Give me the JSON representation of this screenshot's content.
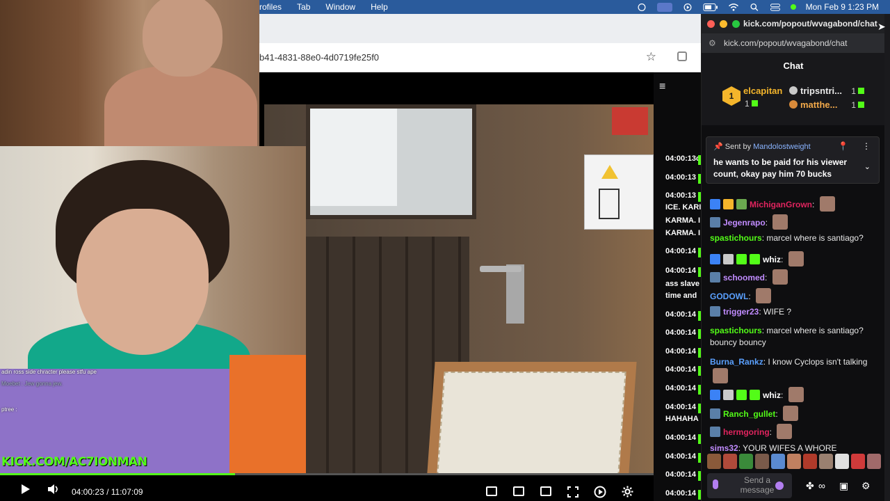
{
  "menubar": {
    "items": [
      "rofiles",
      "Tab",
      "Window",
      "Help"
    ],
    "clock": "Mon Feb 9  1:23 PM"
  },
  "browser": {
    "url_fragment": "b41-4831-88e0-4d0719fe25f0",
    "bookmark_icon": "star-icon"
  },
  "stream": {
    "overlay_lines": [
      "adin ross side chracter please stfu ape",
      "Moebet : Jew gonna jew.",
      "ptree : "
    ],
    "banner": "KICK.COM/AC7IONMAN",
    "progress_fraction": 0.36,
    "accent": "#53fc18"
  },
  "player": {
    "current_time": "04:00:23",
    "separator": "/",
    "duration": "11:07:09"
  },
  "strip": {
    "rows": [
      {
        "ts": "04:00:13",
        "text": "c"
      },
      {
        "ts": "04:00:13",
        "text": ""
      },
      {
        "ts": "04:00:13",
        "text": ""
      },
      {
        "ts": "",
        "text": "ICE. KARI"
      },
      {
        "ts": "",
        "text": "KARMA. I"
      },
      {
        "ts": "",
        "text": "KARMA. I"
      },
      {
        "ts": "04:00:14",
        "text": ""
      },
      {
        "ts": "04:00:14",
        "text": ""
      },
      {
        "ts": "",
        "text": "ass slave"
      },
      {
        "ts": "",
        "text": "time and"
      },
      {
        "ts": "04:00:14",
        "text": ""
      },
      {
        "ts": "04:00:14",
        "text": ""
      },
      {
        "ts": "04:00:14",
        "text": ""
      },
      {
        "ts": "04:00:14",
        "text": ""
      },
      {
        "ts": "04:00:14",
        "text": ""
      },
      {
        "ts": "04:00:14",
        "text": ""
      },
      {
        "ts": "",
        "text": "HAHAHA"
      },
      {
        "ts": "04:00:14",
        "text": ""
      },
      {
        "ts": "04:00:14",
        "text": ""
      },
      {
        "ts": "04:00:14",
        "text": ""
      },
      {
        "ts": "04:00:14",
        "text": ""
      }
    ]
  },
  "popout": {
    "title": "kick.com/popout/wvagabond/chat",
    "url": "kick.com/popout/wvagabond/chat",
    "header": "Chat"
  },
  "leaderboard": {
    "first": {
      "rank": "1",
      "name": "elcapitan",
      "count": "1"
    },
    "second": {
      "name": "tripsntri...",
      "count": "1"
    },
    "third": {
      "name": "matthe...",
      "count": "1"
    }
  },
  "pinned": {
    "sent_by_label": "Sent by",
    "sender": "Mandolostweight",
    "message": "he wants to be paid for his viewer count, okay pay him 70 bucks"
  },
  "chat": {
    "messages": [
      {
        "user": "MichiganGrown",
        "color": "#e0245e",
        "text": ""
      },
      {
        "user": "Jegenrapo",
        "color": "#c18cff",
        "text": ""
      },
      {
        "user": "spastichours",
        "color": "#53fc18",
        "text": "marcel where is santiago?"
      },
      {
        "user": "whiz",
        "color": "#ffffff",
        "text": ""
      },
      {
        "user": "schoomed",
        "color": "#c18cff",
        "text": ""
      },
      {
        "user": "GODOWL",
        "color": "#5aa0ff",
        "text": ""
      },
      {
        "user": "trigger23",
        "color": "#c18cff",
        "text": "WIFE ?"
      },
      {
        "user": "spastichours",
        "color": "#53fc18",
        "text": "marcel where is santiago? bouncy bouncy"
      },
      {
        "user": "Burna_Rankz",
        "color": "#5aa0ff",
        "text": "I know Cyclops isn't talking"
      },
      {
        "user": "whiz",
        "color": "#ffffff",
        "text": ""
      },
      {
        "user": "Ranch_gullet",
        "color": "#53fc18",
        "text": ""
      },
      {
        "user": "hermgoring",
        "color": "#e0245e",
        "text": ""
      },
      {
        "user": "sims32",
        "color": "#c18cff",
        "text": "YOUR WIFES A WHORE"
      }
    ]
  },
  "input": {
    "placeholder": "Send a message"
  }
}
